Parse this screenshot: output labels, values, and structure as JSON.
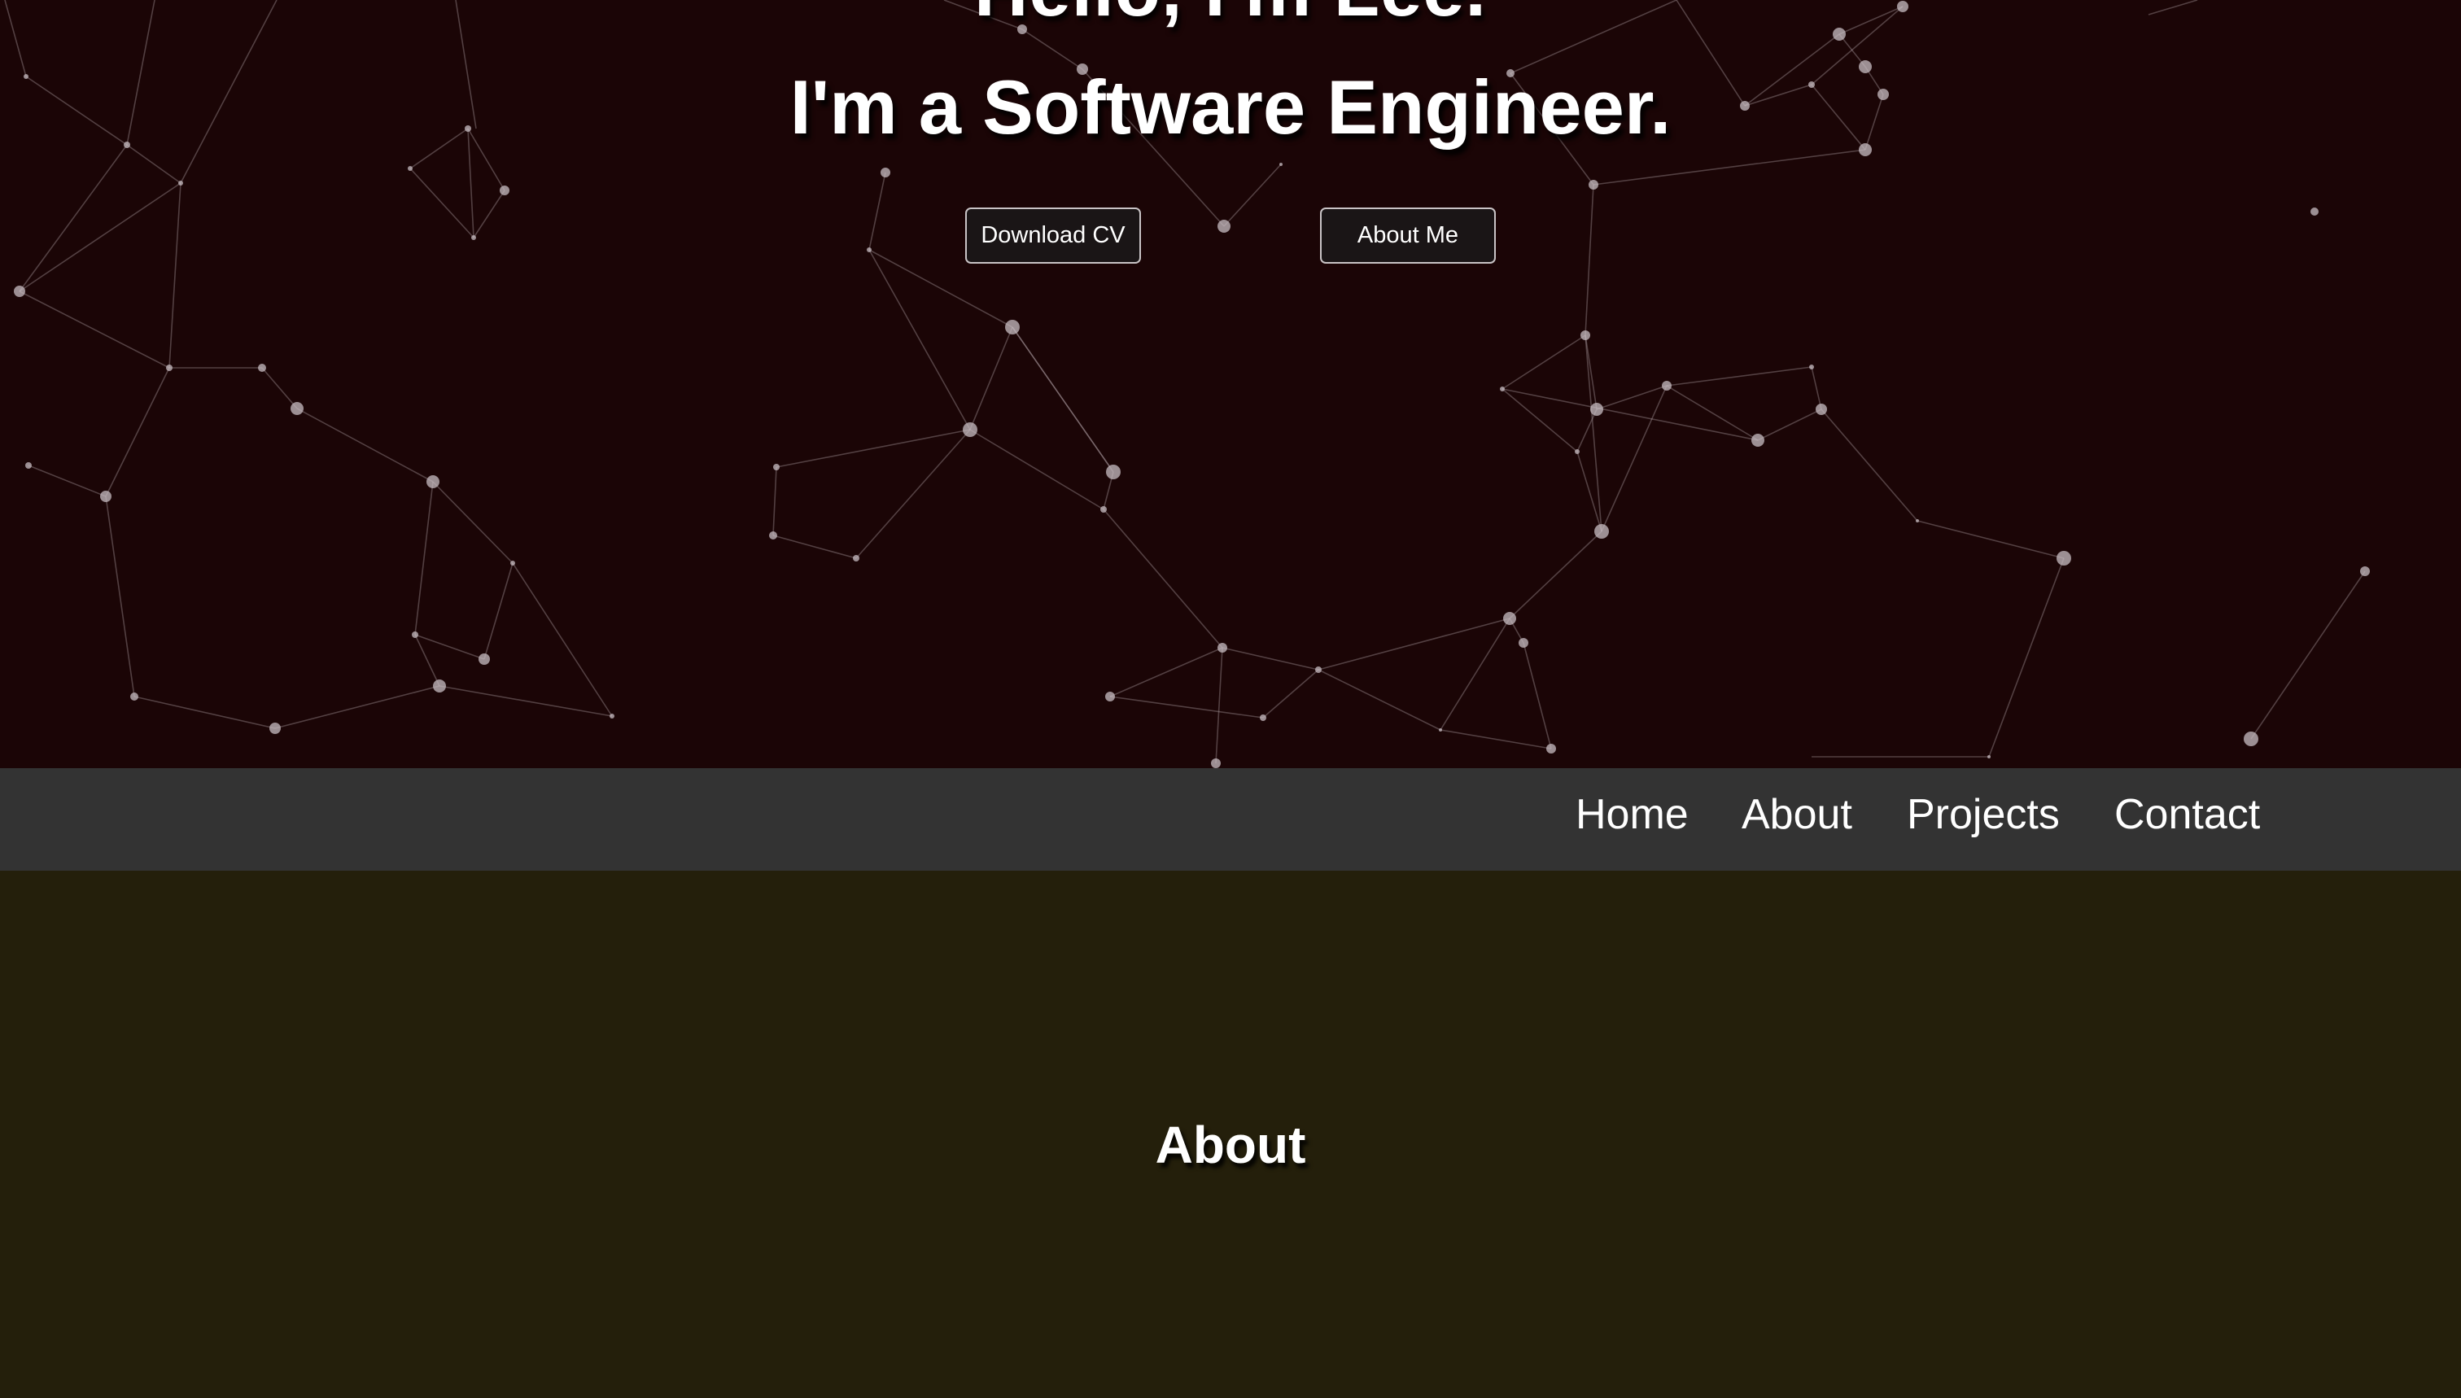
{
  "hero": {
    "headline_partial": "Hello, I'm Lee.",
    "role_title": "I'm a Software Engineer.",
    "download_cv_label": "Download CV",
    "about_me_label": "About Me",
    "background_color": "#1b0506"
  },
  "nav": {
    "items": [
      {
        "label": "Home"
      },
      {
        "label": "About"
      },
      {
        "label": "Projects"
      },
      {
        "label": "Contact"
      }
    ],
    "background_color": "#333333"
  },
  "about": {
    "heading": "About",
    "background_color": "#241f0b"
  }
}
